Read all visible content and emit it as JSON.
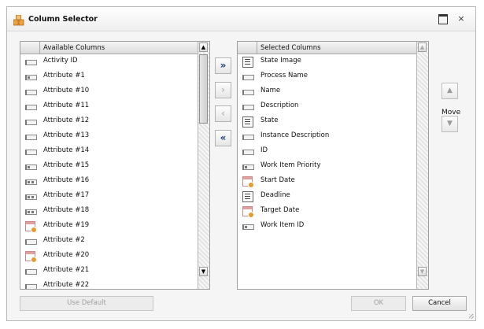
{
  "dialog": {
    "title": "Column Selector",
    "maximize_icon": "maximize-icon",
    "close_glyph": "×"
  },
  "available": {
    "header": "Available Columns",
    "items": [
      {
        "label": "Activity ID",
        "icon": "text-field-icon"
      },
      {
        "label": "Attribute #1",
        "icon": "number-field-icon"
      },
      {
        "label": "Attribute #10",
        "icon": "text-field-icon"
      },
      {
        "label": "Attribute #11",
        "icon": "text-field-icon"
      },
      {
        "label": "Attribute #12",
        "icon": "text-field-icon"
      },
      {
        "label": "Attribute #13",
        "icon": "text-field-icon"
      },
      {
        "label": "Attribute #14",
        "icon": "text-field-icon"
      },
      {
        "label": "Attribute #15",
        "icon": "number-field-icon"
      },
      {
        "label": "Attribute #16",
        "icon": "decimal-field-icon"
      },
      {
        "label": "Attribute #17",
        "icon": "decimal-field-icon"
      },
      {
        "label": "Attribute #18",
        "icon": "decimal-field-icon"
      },
      {
        "label": "Attribute #19",
        "icon": "date-time-icon"
      },
      {
        "label": "Attribute #2",
        "icon": "text-field-icon"
      },
      {
        "label": "Attribute #20",
        "icon": "date-time-icon"
      },
      {
        "label": "Attribute #21",
        "icon": "text-field-icon"
      },
      {
        "label": "Attribute #22",
        "icon": "text-field-icon"
      }
    ]
  },
  "selected": {
    "header": "Selected Columns",
    "items": [
      {
        "label": "State Image",
        "icon": "image-list-icon"
      },
      {
        "label": "Process Name",
        "icon": "text-field-icon"
      },
      {
        "label": "Name",
        "icon": "text-field-icon"
      },
      {
        "label": "Description",
        "icon": "text-field-icon"
      },
      {
        "label": "State",
        "icon": "image-list-icon"
      },
      {
        "label": "Instance Description",
        "icon": "text-field-icon"
      },
      {
        "label": "ID",
        "icon": "text-field-icon"
      },
      {
        "label": "Work Item Priority",
        "icon": "number-field-icon"
      },
      {
        "label": "Start Date",
        "icon": "date-time-icon"
      },
      {
        "label": "Deadline",
        "icon": "image-list-icon"
      },
      {
        "label": "Target Date",
        "icon": "date-time-icon"
      },
      {
        "label": "Work Item ID",
        "icon": "number-field-icon"
      }
    ]
  },
  "transfer": {
    "add_all": "»",
    "add": "›",
    "remove": "‹",
    "remove_all": "«"
  },
  "move": {
    "label": "Move",
    "up": "▲",
    "down": "▼"
  },
  "footer": {
    "use_default": "Use Default",
    "ok": "OK",
    "cancel": "Cancel"
  },
  "scroll": {
    "up": "▲",
    "down": "▼"
  },
  "colors": {
    "arrow_active": "#1b3d6e",
    "disabled_text": "#a0a0a0"
  }
}
